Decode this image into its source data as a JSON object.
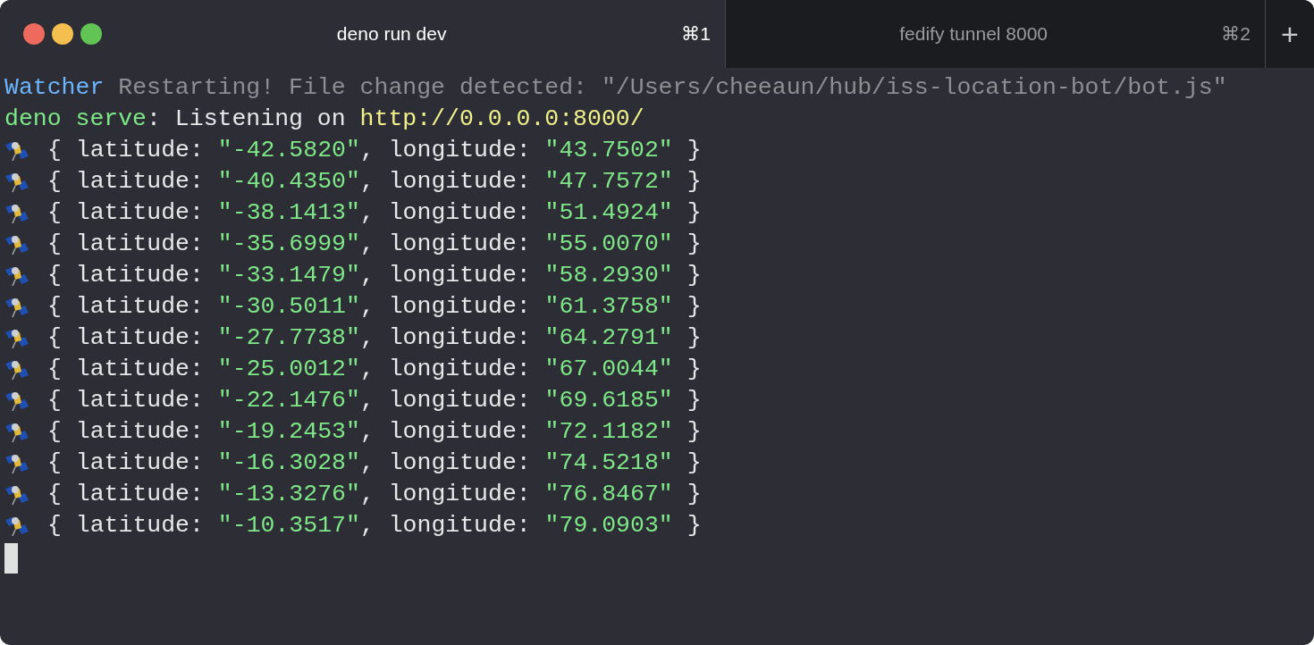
{
  "tabs": [
    {
      "title": "deno run dev",
      "shortcut": "⌘1",
      "selected": true
    },
    {
      "title": "fedify tunnel 8000",
      "shortcut": "⌘2",
      "selected": false
    }
  ],
  "new_tab": "+",
  "lines": [
    {
      "kind": "text",
      "parts": [
        {
          "kind": "label",
          "text": "Watcher"
        },
        {
          "kind": "dim",
          "text": " Restarting! File change detected: \"/Users/cheeaun/hub/iss-location-bot/bot.js\""
        }
      ]
    },
    {
      "kind": "text",
      "parts": [
        {
          "kind": "green",
          "text": "deno serve"
        },
        {
          "kind": "plain",
          "text": ": Listening on "
        },
        {
          "kind": "url",
          "text": "http://0.0.0.0:8000/"
        }
      ]
    },
    {
      "kind": "satellite",
      "parts": [
        {
          "kind": "plain",
          "text": "{ latitude: "
        },
        {
          "kind": "green",
          "text": "\"-42.5820\""
        },
        {
          "kind": "plain",
          "text": ", longitude: "
        },
        {
          "kind": "green",
          "text": "\"43.7502\""
        },
        {
          "kind": "plain",
          "text": " }"
        }
      ]
    },
    {
      "kind": "satellite",
      "parts": [
        {
          "kind": "plain",
          "text": "{ latitude: "
        },
        {
          "kind": "green",
          "text": "\"-40.4350\""
        },
        {
          "kind": "plain",
          "text": ", longitude: "
        },
        {
          "kind": "green",
          "text": "\"47.7572\""
        },
        {
          "kind": "plain",
          "text": " }"
        }
      ]
    },
    {
      "kind": "satellite",
      "parts": [
        {
          "kind": "plain",
          "text": "{ latitude: "
        },
        {
          "kind": "green",
          "text": "\"-38.1413\""
        },
        {
          "kind": "plain",
          "text": ", longitude: "
        },
        {
          "kind": "green",
          "text": "\"51.4924\""
        },
        {
          "kind": "plain",
          "text": " }"
        }
      ]
    },
    {
      "kind": "satellite",
      "parts": [
        {
          "kind": "plain",
          "text": "{ latitude: "
        },
        {
          "kind": "green",
          "text": "\"-35.6999\""
        },
        {
          "kind": "plain",
          "text": ", longitude: "
        },
        {
          "kind": "green",
          "text": "\"55.0070\""
        },
        {
          "kind": "plain",
          "text": " }"
        }
      ]
    },
    {
      "kind": "satellite",
      "parts": [
        {
          "kind": "plain",
          "text": "{ latitude: "
        },
        {
          "kind": "green",
          "text": "\"-33.1479\""
        },
        {
          "kind": "plain",
          "text": ", longitude: "
        },
        {
          "kind": "green",
          "text": "\"58.2930\""
        },
        {
          "kind": "plain",
          "text": " }"
        }
      ]
    },
    {
      "kind": "satellite",
      "parts": [
        {
          "kind": "plain",
          "text": "{ latitude: "
        },
        {
          "kind": "green",
          "text": "\"-30.5011\""
        },
        {
          "kind": "plain",
          "text": ", longitude: "
        },
        {
          "kind": "green",
          "text": "\"61.3758\""
        },
        {
          "kind": "plain",
          "text": " }"
        }
      ]
    },
    {
      "kind": "satellite",
      "parts": [
        {
          "kind": "plain",
          "text": "{ latitude: "
        },
        {
          "kind": "green",
          "text": "\"-27.7738\""
        },
        {
          "kind": "plain",
          "text": ", longitude: "
        },
        {
          "kind": "green",
          "text": "\"64.2791\""
        },
        {
          "kind": "plain",
          "text": " }"
        }
      ]
    },
    {
      "kind": "satellite",
      "parts": [
        {
          "kind": "plain",
          "text": "{ latitude: "
        },
        {
          "kind": "green",
          "text": "\"-25.0012\""
        },
        {
          "kind": "plain",
          "text": ", longitude: "
        },
        {
          "kind": "green",
          "text": "\"67.0044\""
        },
        {
          "kind": "plain",
          "text": " }"
        }
      ]
    },
    {
      "kind": "satellite",
      "parts": [
        {
          "kind": "plain",
          "text": "{ latitude: "
        },
        {
          "kind": "green",
          "text": "\"-22.1476\""
        },
        {
          "kind": "plain",
          "text": ", longitude: "
        },
        {
          "kind": "green",
          "text": "\"69.6185\""
        },
        {
          "kind": "plain",
          "text": " }"
        }
      ]
    },
    {
      "kind": "satellite",
      "parts": [
        {
          "kind": "plain",
          "text": "{ latitude: "
        },
        {
          "kind": "green",
          "text": "\"-19.2453\""
        },
        {
          "kind": "plain",
          "text": ", longitude: "
        },
        {
          "kind": "green",
          "text": "\"72.1182\""
        },
        {
          "kind": "plain",
          "text": " }"
        }
      ]
    },
    {
      "kind": "satellite",
      "parts": [
        {
          "kind": "plain",
          "text": "{ latitude: "
        },
        {
          "kind": "green",
          "text": "\"-16.3028\""
        },
        {
          "kind": "plain",
          "text": ", longitude: "
        },
        {
          "kind": "green",
          "text": "\"74.5218\""
        },
        {
          "kind": "plain",
          "text": " }"
        }
      ]
    },
    {
      "kind": "satellite",
      "parts": [
        {
          "kind": "plain",
          "text": "{ latitude: "
        },
        {
          "kind": "green",
          "text": "\"-13.3276\""
        },
        {
          "kind": "plain",
          "text": ", longitude: "
        },
        {
          "kind": "green",
          "text": "\"76.8467\""
        },
        {
          "kind": "plain",
          "text": " }"
        }
      ]
    },
    {
      "kind": "satellite",
      "parts": [
        {
          "kind": "plain",
          "text": "{ latitude: "
        },
        {
          "kind": "green",
          "text": "\"-10.3517\""
        },
        {
          "kind": "plain",
          "text": ", longitude: "
        },
        {
          "kind": "green",
          "text": "\"79.0903\""
        },
        {
          "kind": "plain",
          "text": " }"
        }
      ]
    }
  ]
}
